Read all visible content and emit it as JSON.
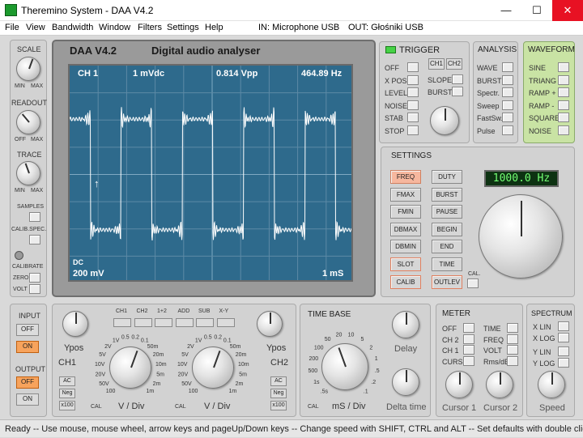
{
  "window": {
    "title": "Theremino System - DAA V4.2",
    "minimize": "—",
    "maximize": "☐",
    "close": "✕"
  },
  "menu": {
    "items": [
      "File",
      "View",
      "Bandwidth",
      "Window",
      "Filters",
      "Settings",
      "Help"
    ],
    "input_device": "IN: Microphone USB",
    "output_device": "OUT: Głośniki USB"
  },
  "left": {
    "scale": "SCALE",
    "min": "MIN",
    "max": "MAX",
    "readout": "READOUT",
    "off": "OFF",
    "trace": "TRACE",
    "samples": "SAMPLES",
    "calib_spec": "CALIB.SPEC.",
    "calibrate": "CALIBRATE",
    "zero": "ZERO",
    "volt": "VOLT"
  },
  "scope": {
    "version": "DAA V4.2",
    "title": "Digital audio analyser",
    "channel": "CH 1",
    "coupling_value": "1 mVdc",
    "vpp": "0.814 Vpp",
    "freq": "464.89 Hz",
    "mode": "DC",
    "volts_div": "200 mV",
    "time_div": "1 mS"
  },
  "trigger": {
    "title": "TRIGGER",
    "items": [
      "OFF",
      "X POS",
      "LEVEL",
      "NOISE",
      "STAB",
      "STOP"
    ],
    "ch1": "CH1",
    "ch2": "CH2",
    "slope": "SLOPE",
    "burst": "BURST"
  },
  "analysis": {
    "title": "ANALYSIS",
    "items": [
      "WAVE",
      "BURST",
      "Spectr.",
      "Sweep",
      "FastSw.",
      "Pulse"
    ]
  },
  "waveform": {
    "title": "WAVEFORM",
    "items": [
      "SINE",
      "TRIANG",
      "RAMP +",
      "RAMP -",
      "SQUARE",
      "NOISE"
    ]
  },
  "settings": {
    "title": "SETTINGS",
    "left_buttons": [
      "FREQ",
      "FMAX",
      "FMIN",
      "DBMAX",
      "DBMIN",
      "SLOT",
      "CALIB"
    ],
    "right_buttons": [
      "DUTY",
      "BURST",
      "PAUSE",
      "BEGIN",
      "END",
      "TIME",
      "OUTLEV"
    ],
    "display": "1000.0 Hz",
    "cal": "CAL."
  },
  "io": {
    "input": "INPUT",
    "input_off": "OFF",
    "input_on": "ON",
    "output": "OUTPUT",
    "output_off": "OFF",
    "output_on": "ON"
  },
  "channels": {
    "ypos": "Ypos",
    "ch1": "CH1",
    "ch2": "CH2",
    "buttons": [
      "CH1",
      "CH2",
      "1+2",
      "ADD",
      "SUB",
      "X-Y"
    ],
    "ac": "AC",
    "neg": "Neg",
    "x100": "x100",
    "vdiv": "V / Div",
    "cal": "CAL",
    "scale_labels": [
      "0.5",
      "0.2",
      "0.1",
      "1V",
      "2V",
      "5V",
      "10V",
      "20V",
      "50V",
      "100",
      "50m",
      "20m",
      "10m",
      "5m",
      "2m",
      "1m"
    ]
  },
  "timebase": {
    "title": "TIME BASE",
    "delay": "Delay",
    "unit": "mS / Div",
    "delta": "Delta time",
    "cal": "CAL",
    "scale_labels": [
      "20",
      "10",
      "5",
      "2",
      "1",
      ".5",
      ".2",
      ".1",
      "50",
      "100",
      "200",
      "500",
      "1s",
      ".5s"
    ]
  },
  "meter": {
    "title": "METER",
    "left": [
      "OFF",
      "CH 2",
      "CH 1",
      "CURS"
    ],
    "right": [
      "TIME",
      "FREQ",
      "VOLT",
      "Rms/dB"
    ],
    "cursor1": "Cursor 1",
    "cursor2": "Cursor 2"
  },
  "spectrum": {
    "title": "SPECTRUM",
    "items": [
      "X LIN",
      "X LOG",
      "Y LIN",
      "Y LOG"
    ],
    "speed": "Speed"
  },
  "status": "Ready -- Use mouse, mouse wheel, arrow keys and pageUp/Down keys -- Change speed with SHIFT, CTRL and ALT -- Set defaults with double click",
  "colors": {
    "screen": "#2e6a8c",
    "trace": "#ffffff",
    "active_button": "#f7a35c",
    "lcd_text": "#74ff74"
  }
}
